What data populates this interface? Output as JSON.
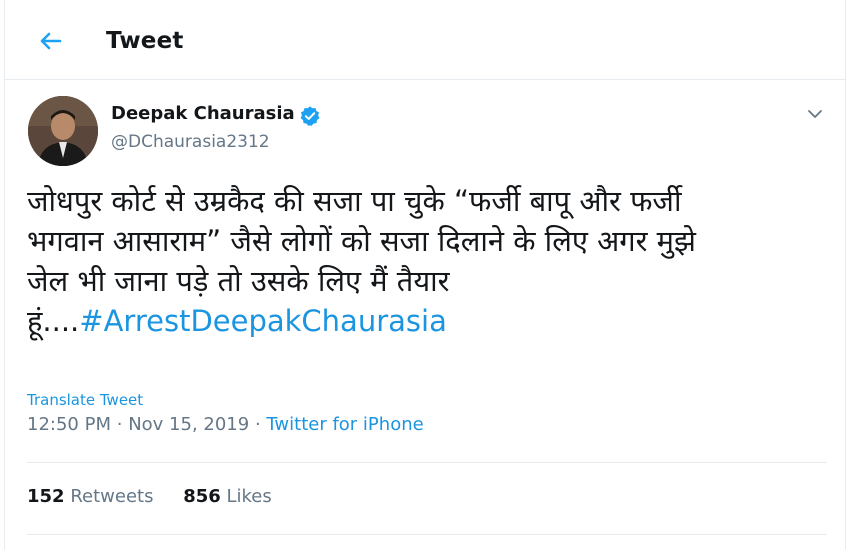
{
  "header": {
    "title": "Tweet",
    "back_icon": "back-arrow-icon"
  },
  "colors": {
    "accent": "#1b95e0",
    "text": "#14171a",
    "muted": "#657786",
    "border": "#e6ecf0"
  },
  "tweet": {
    "author": {
      "name": "Deepak Chaurasia",
      "handle": "@DChaurasia2312",
      "verified_icon": "verified-badge-icon"
    },
    "text_lines": [
      "जोधपुर कोर्ट से उम्रकैद की सजा पा चुके “फर्जी बापू और फर्जी",
      "भगवान आसाराम” जैसे लोगों को सजा दिलाने के लिए अगर मुझे",
      "जेल भी जाना पड़े तो उसके लिए मैं तैयार"
    ],
    "last_line_prefix": "हूं....",
    "hashtag": "#ArrestDeepakChaurasia",
    "translate_label": "Translate Tweet",
    "time": "12:50 PM",
    "date": "Nov 15, 2019",
    "separator": "·",
    "source": "Twitter for iPhone",
    "retweets_count": "152",
    "retweets_label": "Retweets",
    "likes_count": "856",
    "likes_label": "Likes"
  }
}
